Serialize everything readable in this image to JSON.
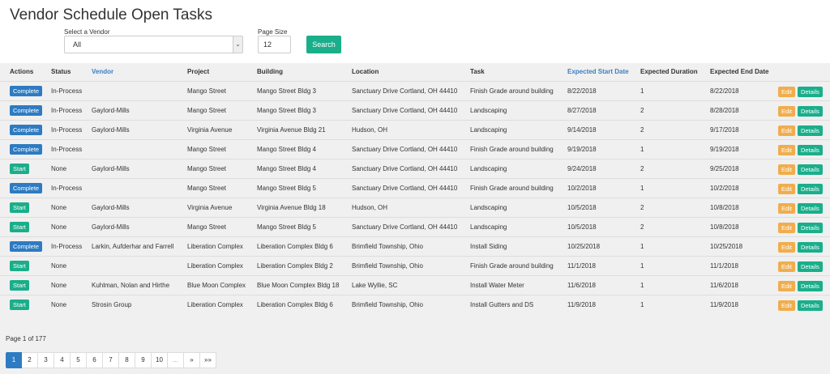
{
  "page_title": "Vendor Schedule Open Tasks",
  "filters": {
    "vendor_label": "Select a Vendor",
    "vendor_value": "All",
    "page_size_label": "Page Size",
    "page_size_value": "12",
    "search_label": "Search"
  },
  "table": {
    "headers": {
      "actions": "Actions",
      "status": "Status",
      "vendor": "Vendor",
      "project": "Project",
      "building": "Building",
      "location": "Location",
      "task": "Task",
      "start": "Expected Start Date",
      "duration": "Expected Duration",
      "end": "Expected End Date"
    },
    "edit_label": "Edit",
    "details_label": "Details",
    "rows": [
      {
        "action": "Complete",
        "status": "In-Process",
        "vendor": "",
        "project": "Mango Street",
        "building": "Mango Street Bldg 3",
        "location": "Sanctuary Drive Cortland, OH 44410",
        "task": "Finish Grade around building",
        "start": "8/22/2018",
        "duration": "1",
        "end": "8/22/2018"
      },
      {
        "action": "Complete",
        "status": "In-Process",
        "vendor": "Gaylord-Mills",
        "project": "Mango Street",
        "building": "Mango Street Bldg 3",
        "location": "Sanctuary Drive Cortland, OH 44410",
        "task": "Landscaping",
        "start": "8/27/2018",
        "duration": "2",
        "end": "8/28/2018"
      },
      {
        "action": "Complete",
        "status": "In-Process",
        "vendor": "Gaylord-Mills",
        "project": "Virginia Avenue",
        "building": "Virginia Avenue Bldg 21",
        "location": "Hudson, OH",
        "task": "Landscaping",
        "start": "9/14/2018",
        "duration": "2",
        "end": "9/17/2018"
      },
      {
        "action": "Complete",
        "status": "In-Process",
        "vendor": "",
        "project": "Mango Street",
        "building": "Mango Street Bldg 4",
        "location": "Sanctuary Drive Cortland, OH 44410",
        "task": "Finish Grade around building",
        "start": "9/19/2018",
        "duration": "1",
        "end": "9/19/2018"
      },
      {
        "action": "Start",
        "status": "None",
        "vendor": "Gaylord-Mills",
        "project": "Mango Street",
        "building": "Mango Street Bldg 4",
        "location": "Sanctuary Drive Cortland, OH 44410",
        "task": "Landscaping",
        "start": "9/24/2018",
        "duration": "2",
        "end": "9/25/2018"
      },
      {
        "action": "Complete",
        "status": "In-Process",
        "vendor": "",
        "project": "Mango Street",
        "building": "Mango Street Bldg 5",
        "location": "Sanctuary Drive Cortland, OH 44410",
        "task": "Finish Grade around building",
        "start": "10/2/2018",
        "duration": "1",
        "end": "10/2/2018"
      },
      {
        "action": "Start",
        "status": "None",
        "vendor": "Gaylord-Mills",
        "project": "Virginia Avenue",
        "building": "Virginia Avenue Bldg 18",
        "location": "Hudson, OH",
        "task": "Landscaping",
        "start": "10/5/2018",
        "duration": "2",
        "end": "10/8/2018"
      },
      {
        "action": "Start",
        "status": "None",
        "vendor": "Gaylord-Mills",
        "project": "Mango Street",
        "building": "Mango Street Bldg 5",
        "location": "Sanctuary Drive Cortland, OH 44410",
        "task": "Landscaping",
        "start": "10/5/2018",
        "duration": "2",
        "end": "10/8/2018"
      },
      {
        "action": "Complete",
        "status": "In-Process",
        "vendor": "Larkin, Aufderhar and Farrell",
        "project": "Liberation Complex",
        "building": "Liberation Complex Bldg 6",
        "location": "Brimfield Township, Ohio",
        "task": "Install Siding",
        "start": "10/25/2018",
        "duration": "1",
        "end": "10/25/2018"
      },
      {
        "action": "Start",
        "status": "None",
        "vendor": "",
        "project": "Liberation Complex",
        "building": "Liberation Complex Bldg 2",
        "location": "Brimfield Township, Ohio",
        "task": "Finish Grade around building",
        "start": "11/1/2018",
        "duration": "1",
        "end": "11/1/2018"
      },
      {
        "action": "Start",
        "status": "None",
        "vendor": "Kuhlman, Nolan and Hirthe",
        "project": "Blue Moon Complex",
        "building": "Blue Moon Complex Bldg 18",
        "location": "Lake Wyllie, SC",
        "task": "Install Water Meter",
        "start": "11/6/2018",
        "duration": "1",
        "end": "11/6/2018"
      },
      {
        "action": "Start",
        "status": "None",
        "vendor": "Strosin Group",
        "project": "Liberation Complex",
        "building": "Liberation Complex Bldg 6",
        "location": "Brimfield Township, Ohio",
        "task": "Install Gutters and DS",
        "start": "11/9/2018",
        "duration": "1",
        "end": "11/9/2018"
      }
    ]
  },
  "pagination": {
    "info": "Page 1 of 177",
    "pages": [
      "1",
      "2",
      "3",
      "4",
      "5",
      "6",
      "7",
      "8",
      "9",
      "10",
      "...",
      "»",
      "»»"
    ],
    "active": "1"
  },
  "colors": {
    "complete": "#2d7bc2",
    "start": "#1aae8a",
    "edit": "#f0ad4e",
    "details": "#1aae8a",
    "sort_link": "#3b7fc4"
  }
}
